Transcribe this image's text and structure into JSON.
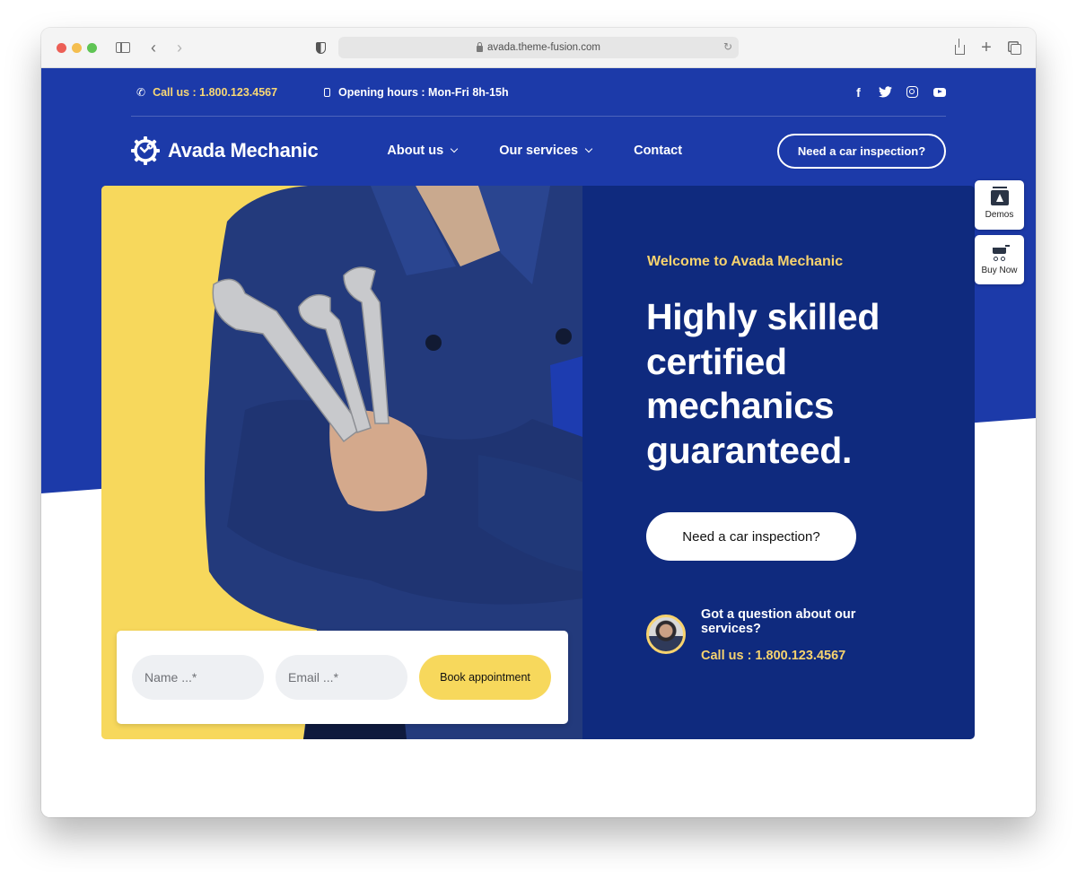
{
  "browser": {
    "url": "avada.theme-fusion.com"
  },
  "topbar": {
    "phone": "Call us : 1.800.123.4567",
    "hours": "Opening hours : Mon-Fri 8h-15h",
    "socials": [
      "facebook",
      "twitter",
      "instagram",
      "youtube"
    ]
  },
  "nav": {
    "logo_text": "Avada Mechanic",
    "items": [
      {
        "label": "About us",
        "has_dropdown": true
      },
      {
        "label": "Our services",
        "has_dropdown": true
      },
      {
        "label": "Contact",
        "has_dropdown": false
      }
    ],
    "cta_label": "Need a car inspection?"
  },
  "hero": {
    "eyebrow": "Welcome to Avada Mechanic",
    "headline": "Highly skilled certified mechanics guaranteed.",
    "cta_label": "Need a car inspection?",
    "question": "Got a question about our services?",
    "phone": "Call us : 1.800.123.4567"
  },
  "form": {
    "name_placeholder": "Name ...*",
    "email_placeholder": "Email ...*",
    "submit_label": "Book appointment"
  },
  "side_widgets": {
    "demos_label": "Demos",
    "buy_label": "Buy Now"
  },
  "colors": {
    "brand_blue": "#1c3aa9",
    "panel_navy": "#0f2a7e",
    "accent_yellow": "#f7d85c",
    "accent_text_yellow": "#f7d36e"
  }
}
